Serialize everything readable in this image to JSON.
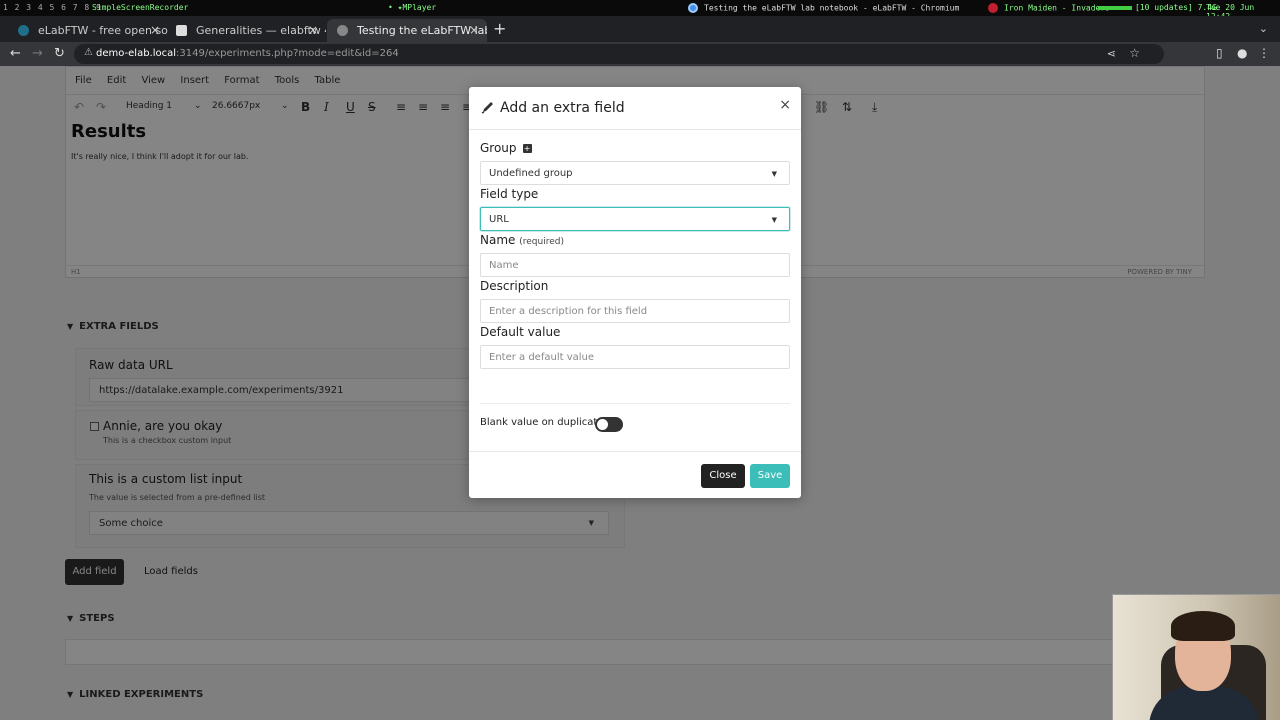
{
  "system_bar": {
    "workspaces": "1 2 3 4 5 6 7 8 9",
    "recorder": "SimpleScreenRecorder",
    "player": "• ✦MPlayer",
    "window_title": "Testing the eLabFTW lab notebook - eLabFTW - Chromium",
    "now_playing": "Iron Maiden - Invaders",
    "updates": "[10 updates] 7.4G",
    "clock": "Tue 20 Jun 12:42"
  },
  "browser": {
    "tabs": [
      {
        "label": "eLabFTW - free open sou"
      },
      {
        "label": "Generalities — elabftw 4."
      },
      {
        "label": "Testing the eLabFTW lab"
      }
    ],
    "url_host": "demo-elab.local",
    "url_rest": ":3149/experiments.php?mode=edit&id=264"
  },
  "editor": {
    "menu": [
      "File",
      "Edit",
      "View",
      "Insert",
      "Format",
      "Tools",
      "Table"
    ],
    "block_format": "Heading 1",
    "font_size": "26.6667px",
    "heading": "Results",
    "paragraph": "It's really nice, I think I'll adopt it for our lab.",
    "path": "H1",
    "powered": "POWERED BY TINY"
  },
  "extra_fields": {
    "section_title": "EXTRA FIELDS",
    "url_field": {
      "label": "Raw data URL",
      "value": "https://datalake.example.com/experiments/3921"
    },
    "checkbox_field": {
      "label": "Annie, are you okay",
      "description": "This is a checkbox custom input"
    },
    "list_field": {
      "label": "This is a custom list input",
      "description": "The value is selected from a pre-defined list",
      "value": "Some choice"
    },
    "add_button": "Add field",
    "load_button": "Load fields"
  },
  "steps": {
    "section_title": "STEPS"
  },
  "linked": {
    "section_title": "LINKED EXPERIMENTS"
  },
  "modal": {
    "title": "Add an extra field",
    "group_label": "Group",
    "group_value": "Undefined group",
    "type_label": "Field type",
    "type_value": "URL",
    "name_label": "Name",
    "name_required": "(required)",
    "name_placeholder": "Name",
    "description_label": "Description",
    "description_placeholder": "Enter a description for this field",
    "default_label": "Default value",
    "default_placeholder": "Enter a default value",
    "blank_label": "Blank value on duplicate",
    "blank_enabled": false,
    "close_button": "Close",
    "save_button": "Save",
    "accent_color": "#3bbdba"
  }
}
